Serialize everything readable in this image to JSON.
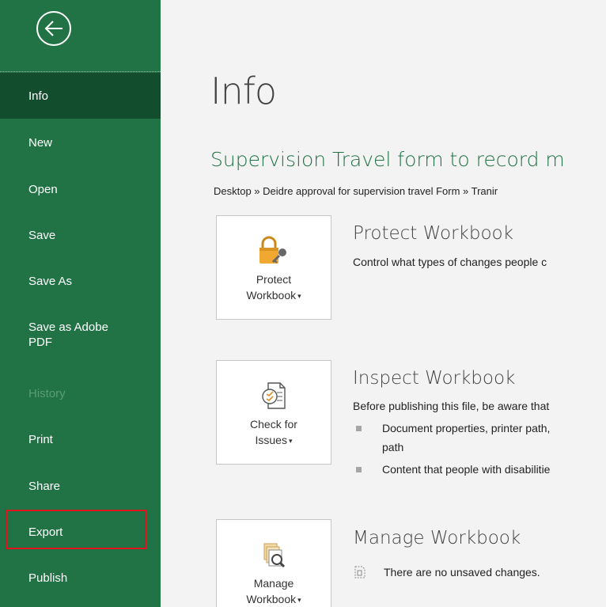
{
  "sidebar": {
    "items": [
      {
        "label": "Info",
        "state": "selected"
      },
      {
        "label": "New",
        "state": "normal"
      },
      {
        "label": "Open",
        "state": "normal"
      },
      {
        "label": "Save",
        "state": "normal"
      },
      {
        "label": "Save As",
        "state": "normal"
      },
      {
        "label": "Save as Adobe",
        "label2": "PDF",
        "state": "normal"
      },
      {
        "label": "History",
        "state": "disabled"
      },
      {
        "label": "Print",
        "state": "normal"
      },
      {
        "label": "Share",
        "state": "normal"
      },
      {
        "label": "Export",
        "state": "highlighted"
      },
      {
        "label": "Publish",
        "state": "normal"
      }
    ]
  },
  "main": {
    "title": "Info",
    "document_title": "Supervision Travel form to record m",
    "breadcrumb": "Desktop » Deidre approval for supervision travel Form » Tranir",
    "protect": {
      "tile_line1": "Protect",
      "tile_line2": "Workbook",
      "heading": "Protect Workbook",
      "description": "Control what types of changes people c"
    },
    "inspect": {
      "tile_line1": "Check for",
      "tile_line2": "Issues",
      "heading": "Inspect Workbook",
      "description": "Before publishing this file, be aware that",
      "bullets": [
        {
          "line1": "Document properties, printer path,",
          "line2": "path"
        },
        {
          "line1": "Content that people with disabilitie"
        }
      ]
    },
    "manage": {
      "tile_line1": "Manage",
      "tile_line2": "Workbook",
      "heading": "Manage Workbook",
      "description": "There are no unsaved changes."
    }
  },
  "colors": {
    "sidebar_bg": "#217346",
    "selected_bg": "#124d2e",
    "accent_green": "#217346",
    "highlight_red": "#e0141e"
  }
}
